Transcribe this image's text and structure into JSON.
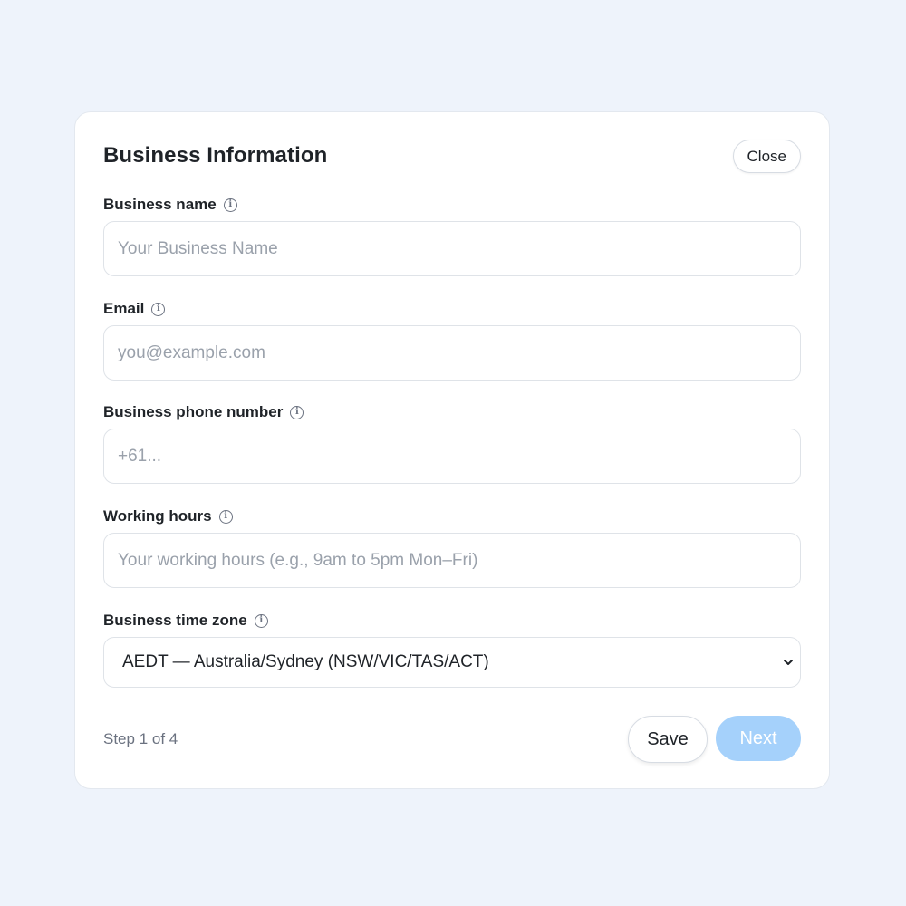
{
  "dialog": {
    "title": "Business Information",
    "close_label": "Close"
  },
  "fields": {
    "business_name": {
      "label": "Business name",
      "placeholder": "Your Business Name",
      "value": ""
    },
    "email": {
      "label": "Email",
      "placeholder": "you@example.com",
      "value": ""
    },
    "phone": {
      "label": "Business phone number",
      "placeholder": "+61...",
      "value": ""
    },
    "working_hours": {
      "label": "Working hours",
      "placeholder": "Your working hours (e.g., 9am to 5pm Mon–Fri)",
      "value": ""
    },
    "time_zone": {
      "label": "Business time zone",
      "selected": "AEDT — Australia/Sydney (NSW/VIC/TAS/ACT)"
    }
  },
  "icons": {
    "info": "info-circle-icon",
    "chevron": "chevron-down-icon"
  },
  "footer": {
    "step_text": "Step 1 of 4",
    "save_label": "Save",
    "next_label": "Next"
  },
  "colors": {
    "background": "#eef3fb",
    "card": "#ffffff",
    "next_button": "#a5d1fb",
    "muted_text": "#6b7280",
    "placeholder": "#9aa1ab"
  }
}
